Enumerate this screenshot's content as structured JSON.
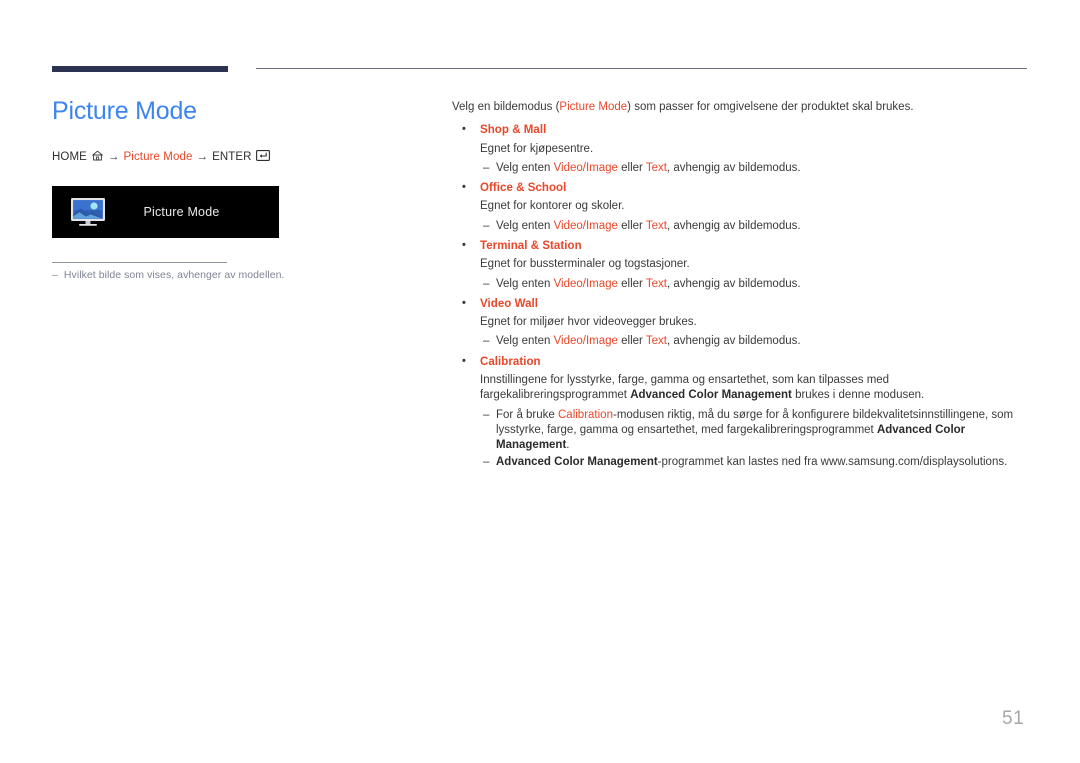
{
  "header": {
    "accent_bar_color": "#2b3350",
    "rule_color": "#6a6d85"
  },
  "left": {
    "page_title": "Picture Mode",
    "breadcrumb": {
      "home_label": "HOME",
      "home_icon": "home-icon",
      "arrow": "→",
      "middle_label": "Picture Mode",
      "enter_label": "ENTER",
      "enter_icon": "enter-key-icon"
    },
    "device_box": {
      "icon": "monitor-picture-icon",
      "label": "Picture Mode",
      "background": "#000000"
    },
    "note": {
      "dash": "–",
      "text": "Hvilket bilde som vises, avhenger av modellen."
    }
  },
  "main": {
    "intro": {
      "before": "Velg en bildemodus (",
      "accent": "Picture Mode",
      "after": ") som passer for omgivelsene der produktet skal brukes."
    },
    "modes": [
      {
        "name": "Shop & Mall",
        "description": "Egnet for kjøpesentre.",
        "subs": [
          {
            "t1": "Velg enten ",
            "a1": "Video/Image",
            "t2": " eller ",
            "a2": "Text",
            "t3": ", avhengig av bildemodus."
          }
        ]
      },
      {
        "name": "Office & School",
        "description": "Egnet for kontorer og skoler.",
        "subs": [
          {
            "t1": "Velg enten ",
            "a1": "Video/Image",
            "t2": " eller ",
            "a2": "Text",
            "t3": ", avhengig av bildemodus."
          }
        ]
      },
      {
        "name": "Terminal & Station",
        "description": "Egnet for bussterminaler og togstasjoner.",
        "subs": [
          {
            "t1": "Velg enten ",
            "a1": "Video/Image",
            "t2": " eller ",
            "a2": "Text",
            "t3": ", avhengig av bildemodus."
          }
        ]
      },
      {
        "name": "Video Wall",
        "description": "Egnet for miljøer hvor videovegger brukes.",
        "subs": [
          {
            "t1": "Velg enten ",
            "a1": "Video/Image",
            "t2": " eller ",
            "a2": "Text",
            "t3": ", avhengig av bildemodus."
          }
        ]
      },
      {
        "name": "Calibration",
        "description_part1": "Innstillingene for lysstyrke, farge, gamma og ensartethet, som kan tilpasses med fargekalibreringsprogrammet ",
        "description_bold": "Advanced Color Management",
        "description_part2": " brukes i denne modusen.",
        "notes": [
          {
            "t1": "For å bruke ",
            "a1": "Calibration",
            "t2": "-modusen riktig, må du sørge for å konfigurere bildekvalitetsinnstillingene, som lysstyrke, farge, gamma og ensartethet, med fargekalibreringsprogrammet ",
            "b1": "Advanced Color Management",
            "t3": "."
          },
          {
            "b1": "Advanced Color Management",
            "t2": "-programmet kan lastes ned fra www.samsung.com/displaysolutions."
          }
        ]
      }
    ]
  },
  "footer": {
    "page_number": "51"
  },
  "colors": {
    "accent_red": "#e8472a",
    "title_blue": "#3d85ec",
    "body_text": "#3a3a3a",
    "note_text": "#7f8496",
    "page_number": "#a7a7a7"
  }
}
